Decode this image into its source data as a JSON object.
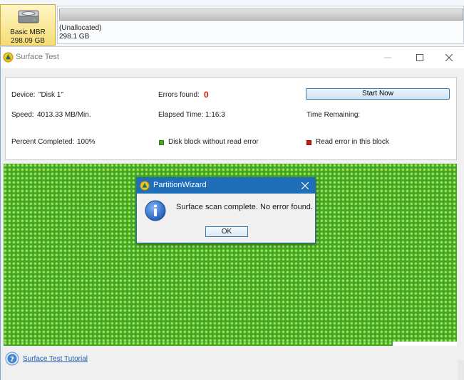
{
  "disk": {
    "tile_label": "Basic MBR",
    "tile_size": "298.09 GB",
    "partition_label": "(Unallocated)",
    "partition_size": "298.1 GB"
  },
  "window": {
    "title": "Surface Test",
    "device_label": "Device:",
    "device_value": "\"Disk 1\"",
    "errors_label": "Errors found:",
    "errors_value": "0",
    "start_button": "Start Now",
    "speed_label": "Speed:",
    "speed_value": "4013.33 MB/Min.",
    "elapsed_label": "Elapsed Time:",
    "elapsed_value": "1:16:3",
    "remaining_label": "Time Remaining:",
    "percent_label": "Percent Completed:",
    "percent_value": "100%",
    "legend_ok": "Disk block without read error",
    "legend_err": "Read error in this block",
    "tutorial_link": "Surface Test Tutorial"
  },
  "dialog": {
    "title": "PartitionWizard",
    "message": "Surface scan complete. No error found.",
    "ok_button": "OK"
  },
  "colors": {
    "ok_block": "#3fae22",
    "error_block": "#d11a0e",
    "dialog_title_bar": "#1e6fb8",
    "link": "#1e5fb3"
  },
  "icons": [
    "hard-disk-icon",
    "partition-wizard-icon",
    "minimize-icon",
    "maximize-icon",
    "close-icon",
    "info-icon",
    "help-icon"
  ]
}
